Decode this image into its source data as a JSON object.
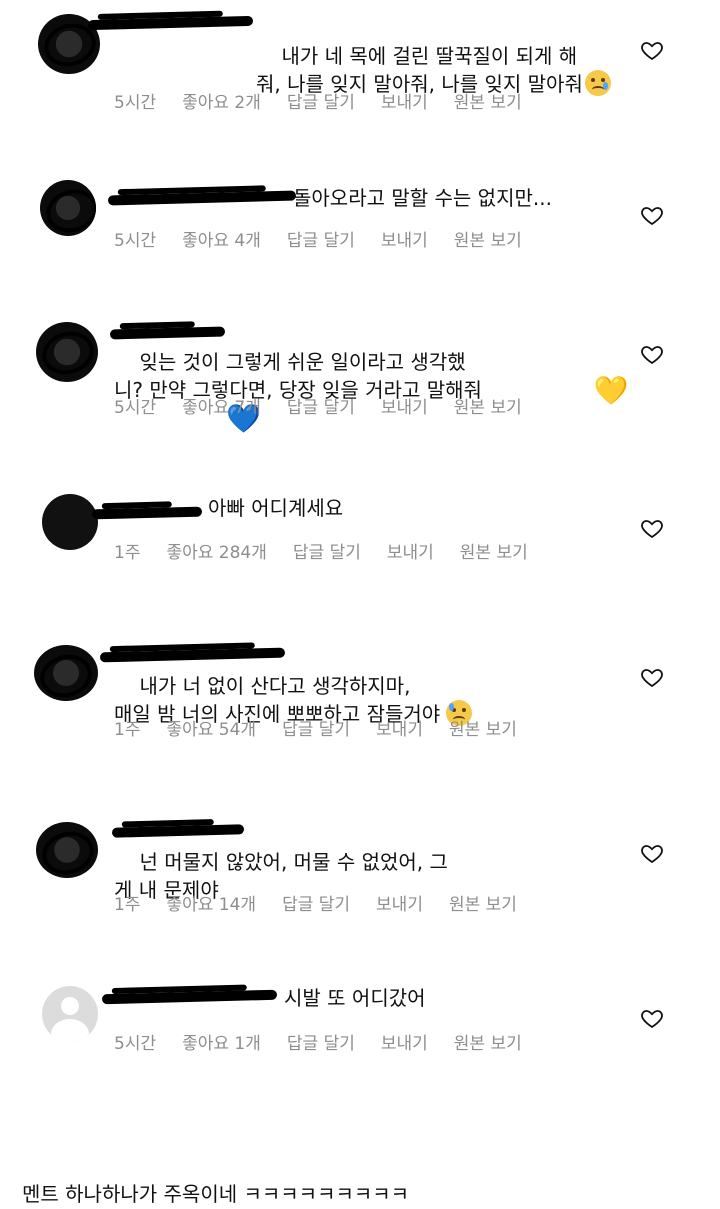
{
  "comments": [
    {
      "text": "내가 네 목에 걸린 딸꾹질이 되게 해\n줘, 나를 잊지 말아줘, 나를 잊지 말아줘",
      "emoji": "crying-face-emoji",
      "time": "5시간",
      "likes": "좋아요 2개",
      "reply": "답글 달기",
      "send": "보내기",
      "original": "원본 보기"
    },
    {
      "text": "돌아오라고 말할 수는 없지만...",
      "time": "5시간",
      "likes": "좋아요 4개",
      "reply": "답글 달기",
      "send": "보내기",
      "original": "원본 보기"
    },
    {
      "text": "잊는 것이 그렇게 쉬운 일이라고 생각했\n니? 만약 그렇다면, 당장 잊을 거라고 말해줘",
      "emoji_yellow": "💛",
      "emoji_blue": "💙",
      "time": "5시간",
      "likes": "좋아요 7개",
      "reply": "답글 달기",
      "send": "보내기",
      "original": "원본 보기"
    },
    {
      "text": "아빠 어디계세요",
      "time": "1주",
      "likes": "좋아요 284개",
      "reply": "답글 달기",
      "send": "보내기",
      "original": "원본 보기"
    },
    {
      "text": "내가 너 없이 산다고 생각하지마,\n매일 밤 너의 사진에 뽀뽀하고 잠들거야",
      "emoji": "sad-sweat-emoji",
      "time": "1주",
      "likes": "좋아요 54개",
      "reply": "답글 달기",
      "send": "보내기",
      "original": "원본 보기"
    },
    {
      "text": "넌 머물지 않았어, 머물 수 없었어, 그\n게 내 문제야",
      "time": "1주",
      "likes": "좋아요 14개",
      "reply": "답글 달기",
      "send": "보내기",
      "original": "원본 보기"
    },
    {
      "text": "시발 또 어디갔어",
      "time": "5시간",
      "likes": "좋아요 1개",
      "reply": "답글 달기",
      "send": "보내기",
      "original": "원본 보기"
    }
  ],
  "footer_caption": "멘트 하나하나가 주옥이네 ㅋㅋㅋㅋㅋㅋㅋㅋㅋ",
  "colors": {
    "meta_gray": "#8e8e8e",
    "text": "#111111"
  },
  "icons": {
    "like": "heart-outline-icon",
    "default_avatar": "default-avatar-icon"
  }
}
